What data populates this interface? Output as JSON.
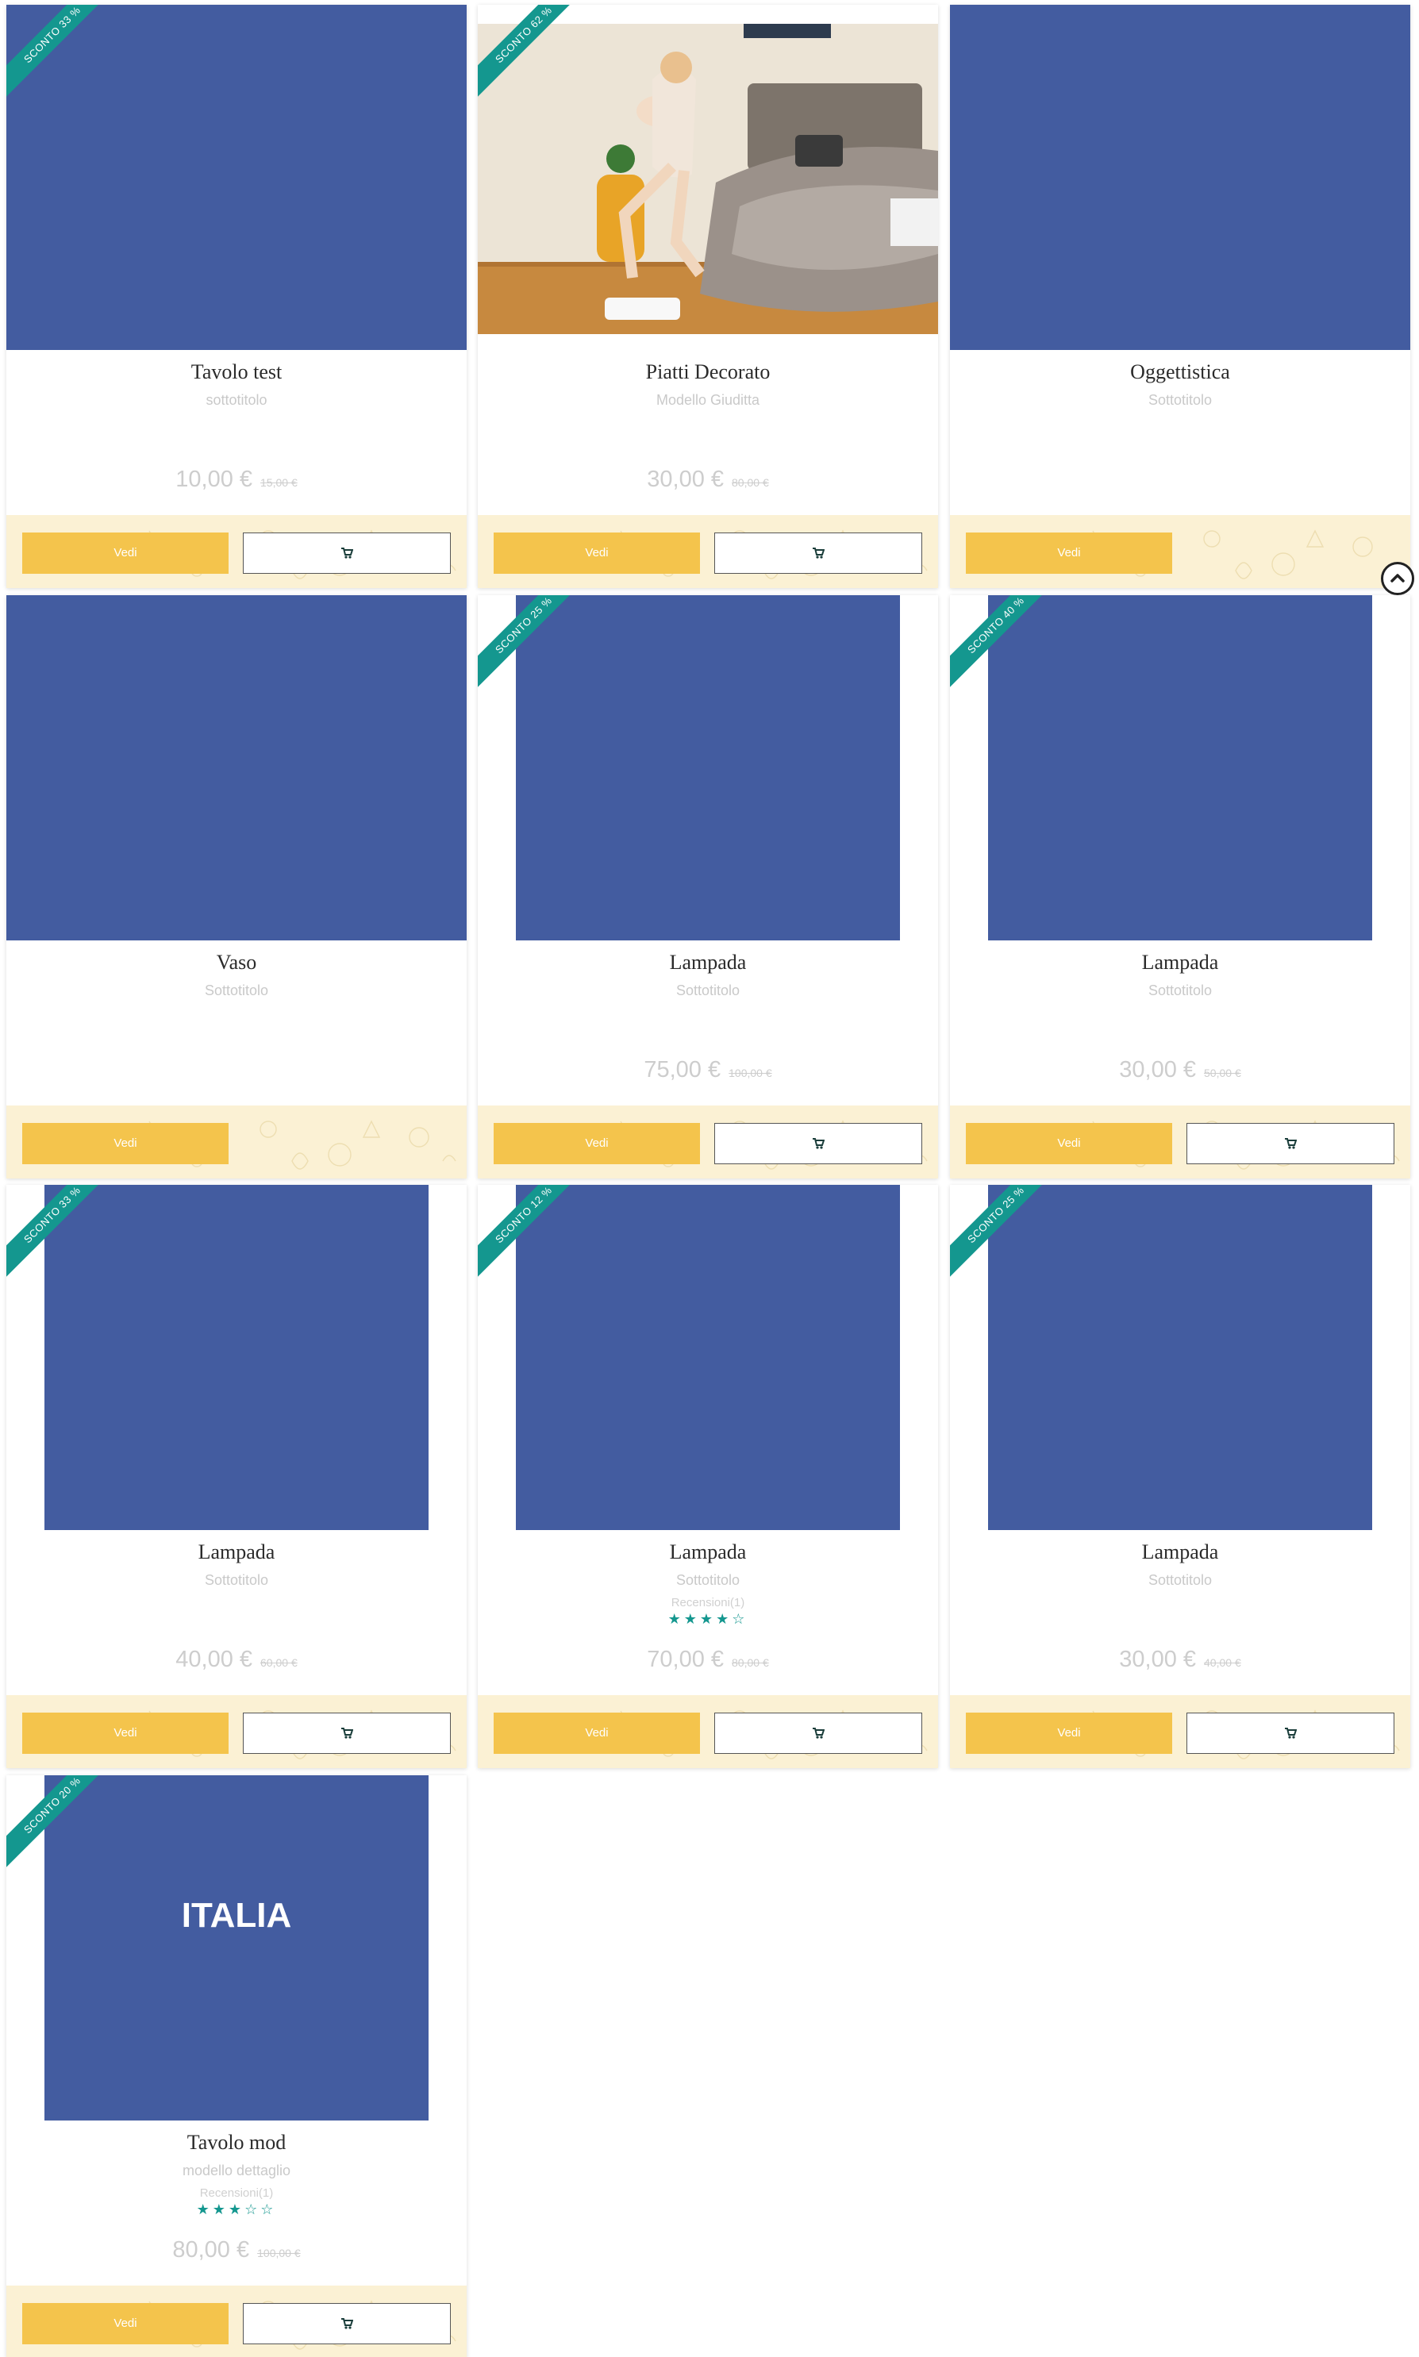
{
  "accent_color": "#14978f",
  "button_color": "#f4c44c",
  "placeholder_color": "#435ca0",
  "cards": [
    {
      "title": "Tavolo test",
      "subtitle": "sottotitolo",
      "discount": "SCONTO 33 %",
      "price": "10,00 €",
      "old_price": "15,00 €",
      "vedi": "Vedi",
      "has_cart": true,
      "image": "placeholder-full"
    },
    {
      "title": "Piatti Decorato",
      "subtitle": "Modello Giuditta",
      "discount": "SCONTO 62 %",
      "price": "30,00 €",
      "old_price": "80,00 €",
      "vedi": "Vedi",
      "has_cart": true,
      "image": "photo-woman-bedroom"
    },
    {
      "title": "Oggettistica",
      "subtitle": "Sottotitolo",
      "discount": "",
      "price": "",
      "old_price": "",
      "vedi": "Vedi",
      "has_cart": false,
      "image": "placeholder-full"
    },
    {
      "title": "Vaso",
      "subtitle": "Sottotitolo",
      "discount": "",
      "price": "",
      "old_price": "",
      "vedi": "Vedi",
      "has_cart": false,
      "image": "placeholder-full"
    },
    {
      "title": "Lampada",
      "subtitle": "Sottotitolo",
      "discount": "SCONTO 25 %",
      "price": "75,00 €",
      "old_price": "100,00 €",
      "vedi": "Vedi",
      "has_cart": true,
      "image": "placeholder-inset"
    },
    {
      "title": "Lampada",
      "subtitle": "Sottotitolo",
      "discount": "SCONTO 40 %",
      "price": "30,00 €",
      "old_price": "50,00 €",
      "vedi": "Vedi",
      "has_cart": true,
      "image": "placeholder-inset"
    },
    {
      "title": "Lampada",
      "subtitle": "Sottotitolo",
      "discount": "SCONTO 33 %",
      "price": "40,00 €",
      "old_price": "60,00 €",
      "vedi": "Vedi",
      "has_cart": true,
      "image": "placeholder-inset"
    },
    {
      "title": "Lampada",
      "subtitle": "Sottotitolo",
      "discount": "SCONTO 12 %",
      "price": "70,00 €",
      "old_price": "80,00 €",
      "vedi": "Vedi",
      "has_cart": true,
      "image": "placeholder-inset",
      "reviews_label": "Recensioni(1)",
      "stars": "★★★★☆"
    },
    {
      "title": "Lampada",
      "subtitle": "Sottotitolo",
      "discount": "SCONTO 25 %",
      "price": "30,00 €",
      "old_price": "40,00 €",
      "vedi": "Vedi",
      "has_cart": true,
      "image": "placeholder-inset"
    },
    {
      "title": "Tavolo mod",
      "subtitle": "modello dettaglio",
      "discount": "SCONTO 20 %",
      "price": "80,00 €",
      "old_price": "100,00 €",
      "vedi": "Vedi",
      "has_cart": true,
      "image": "placeholder-inset",
      "image_text": "ITALIA",
      "reviews_label": "Recensioni(1)",
      "stars": "★★★☆☆"
    }
  ],
  "icons": {
    "cart": "cart-icon",
    "scroll_top": "chevron-up-icon",
    "footer_pattern": "floral-pattern-icon"
  }
}
